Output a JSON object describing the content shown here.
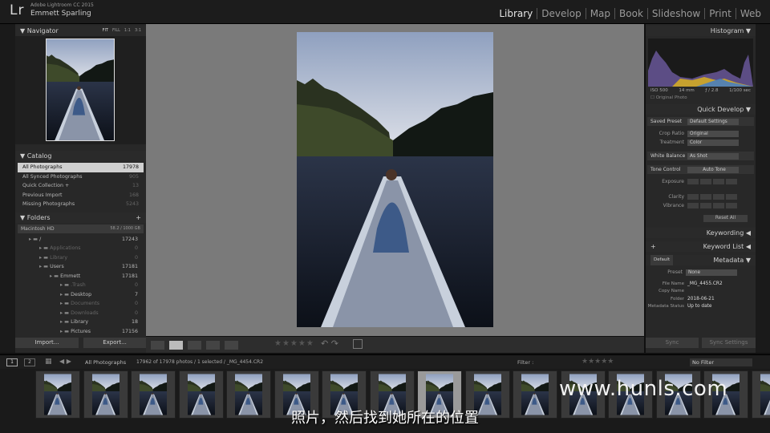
{
  "app": {
    "logo": "Lr",
    "title": "Adobe Lightroom CC 2015",
    "user": "Emmett Sparling"
  },
  "modules": [
    "Library",
    "Develop",
    "Map",
    "Book",
    "Slideshow",
    "Print",
    "Web"
  ],
  "active_module": "Library",
  "navigator": {
    "title": "Navigator",
    "zoom": [
      "FIT",
      "FILL",
      "1:1",
      "3:1"
    ]
  },
  "catalog": {
    "title": "Catalog",
    "items": [
      {
        "label": "All Photographs",
        "count": "17978",
        "selected": true
      },
      {
        "label": "All Synced Photographs",
        "count": "905"
      },
      {
        "label": "Quick Collection +",
        "count": "13"
      },
      {
        "label": "Previous Import",
        "count": "168"
      },
      {
        "label": "Missing Photographs",
        "count": "5243"
      }
    ]
  },
  "folders": {
    "title": "Folders",
    "add": "+",
    "volume": {
      "name": "Macintosh HD",
      "size": "58.2 / 1000 GB"
    },
    "items": [
      {
        "label": "/",
        "count": "17243",
        "indent": 1,
        "dim": false
      },
      {
        "label": "Applications",
        "count": "0",
        "indent": 2,
        "dim": true
      },
      {
        "label": "Library",
        "count": "0",
        "indent": 2,
        "dim": true
      },
      {
        "label": "Users",
        "count": "17181",
        "indent": 2,
        "dim": false
      },
      {
        "label": "Emmett",
        "count": "17181",
        "indent": 3,
        "dim": false
      },
      {
        "label": ".Trash",
        "count": "0",
        "indent": 4,
        "dim": true
      },
      {
        "label": "Desktop",
        "count": "7",
        "indent": 4,
        "dim": false
      },
      {
        "label": "Documents",
        "count": "0",
        "indent": 4,
        "dim": true
      },
      {
        "label": "Downloads",
        "count": "0",
        "indent": 4,
        "dim": true
      },
      {
        "label": "Library",
        "count": "18",
        "indent": 4,
        "dim": false
      },
      {
        "label": "Pictures",
        "count": "17156",
        "indent": 4,
        "dim": false
      }
    ]
  },
  "left_buttons": {
    "import": "Import...",
    "export": "Export..."
  },
  "histogram": {
    "title": "Histogram",
    "iso": "ISO 500",
    "focal": "14 mm",
    "aperture": "ƒ / 2.8",
    "shutter": "1/100 sec",
    "original": "Original Photo"
  },
  "quick_develop": {
    "title": "Quick Develop",
    "saved_preset": {
      "label": "Saved Preset",
      "value": "Default Settings"
    },
    "crop": {
      "label": "Crop Ratio",
      "value": "Original"
    },
    "treatment": {
      "label": "Treatment",
      "value": "Color"
    },
    "wb": {
      "label": "White Balance",
      "value": "As Shot"
    },
    "tone": {
      "label": "Tone Control",
      "value": "Auto Tone"
    },
    "exposure": "Exposure",
    "clarity": "Clarity",
    "vibrance": "Vibrance",
    "reset": "Reset All"
  },
  "keywording": "Keywording",
  "keyword_list": "Keyword List",
  "metadata": {
    "title": "Metadata",
    "set": "Default",
    "preset_label": "Preset",
    "preset_value": "None",
    "rows": [
      {
        "label": "File Name",
        "value": "_MG_4455.CR2"
      },
      {
        "label": "Copy Name",
        "value": ""
      },
      {
        "label": "Folder",
        "value": "2018-06-21"
      },
      {
        "label": "Metadata Status",
        "value": "Up to date"
      }
    ]
  },
  "right_buttons": {
    "sync": "Sync",
    "sync_settings": "Sync Settings"
  },
  "filmstrip_bar": {
    "page1": "1",
    "page2": "2",
    "source": "All Photographs",
    "info": "17962 of 17978 photos / 1 selected / _MG_4454.CR2",
    "filter_label": "Filter :",
    "filter_value": "No Filter"
  },
  "subtitle": "照片，然后找到她所在的位置",
  "watermark": "www.hunls.com",
  "colors": {
    "accent": "#d0d0d0",
    "panel": "#282828",
    "canvas": "#7a7a7a"
  }
}
